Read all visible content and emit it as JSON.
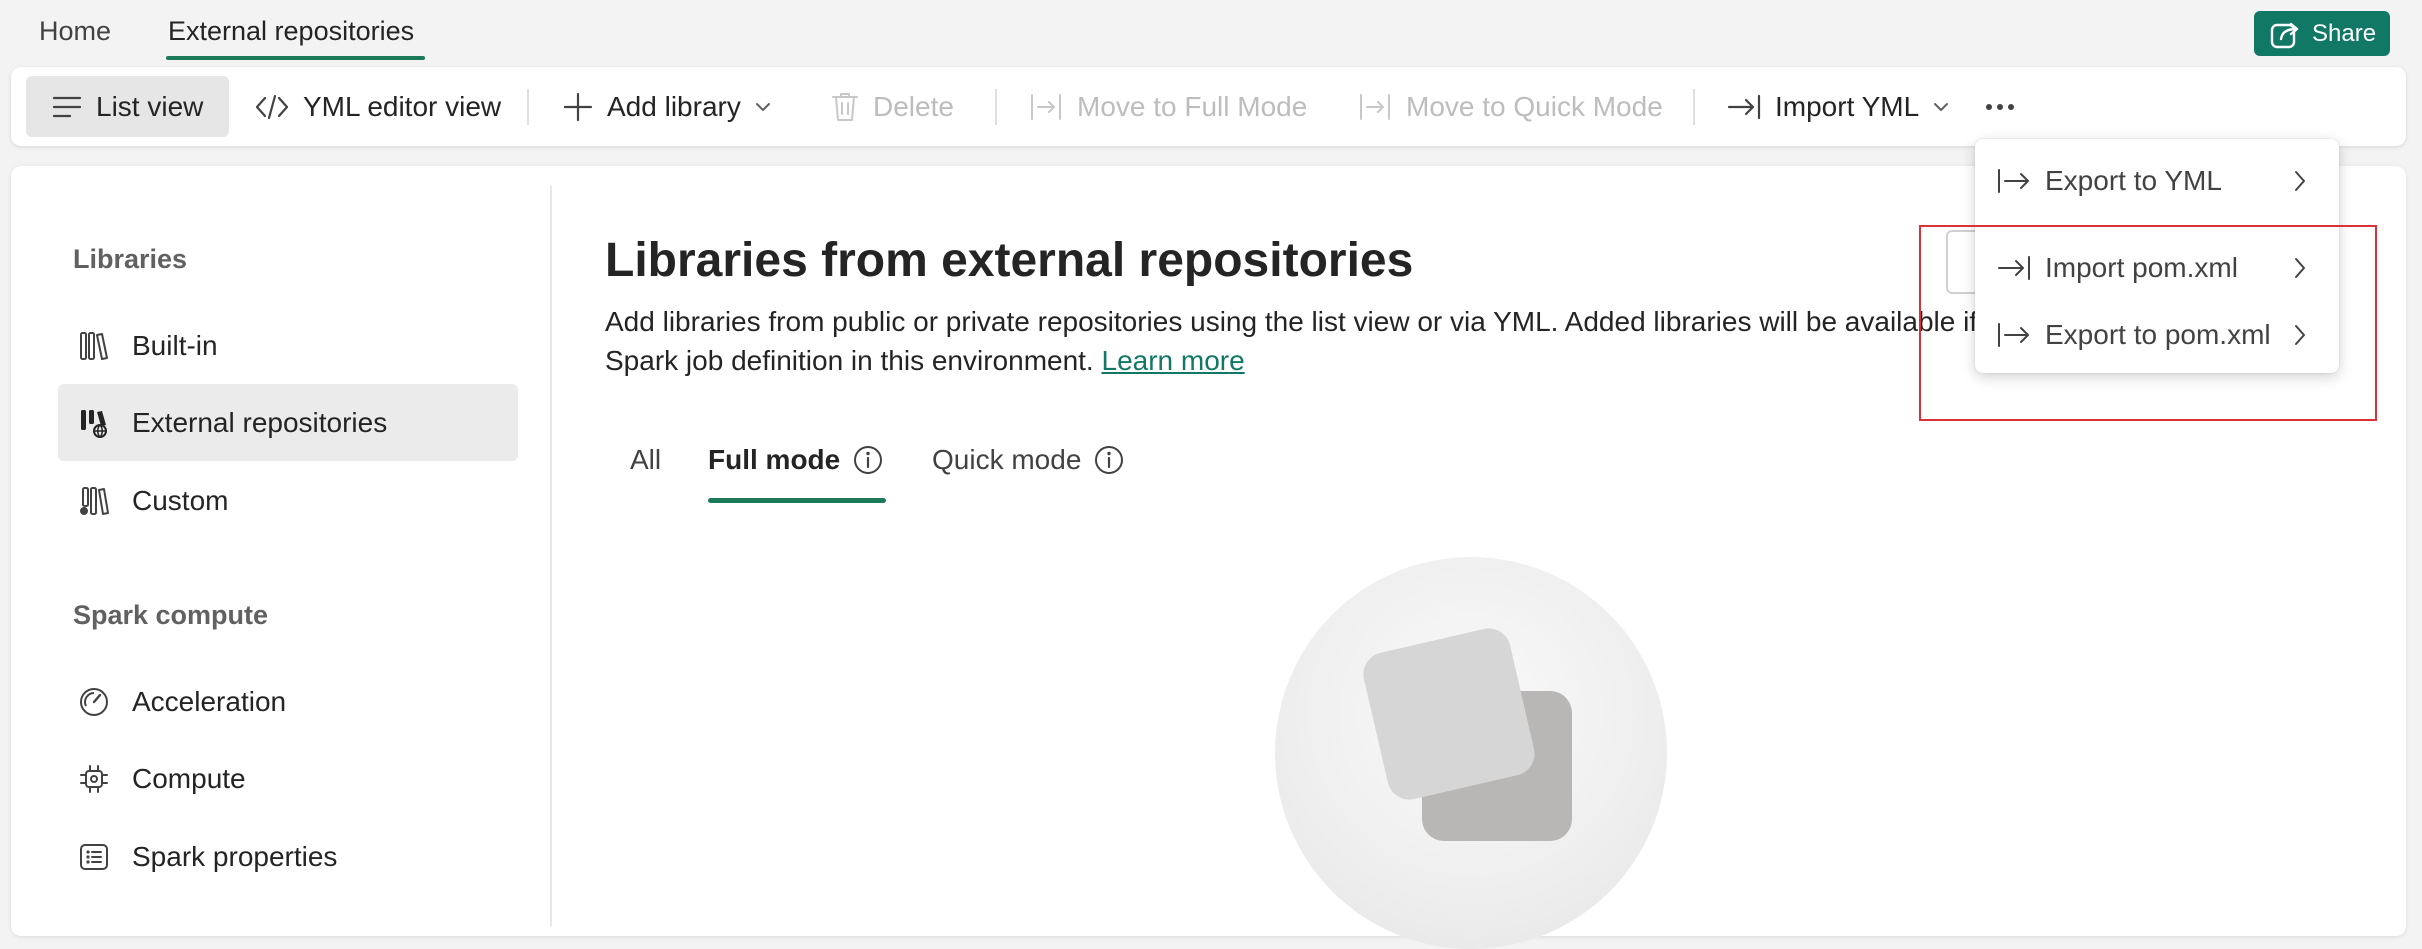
{
  "topnav": {
    "tabs": [
      {
        "label": "Home"
      },
      {
        "label": "External repositories"
      }
    ],
    "share_label": "Share"
  },
  "toolbar": {
    "list_view": "List view",
    "yml_editor_view": "YML editor view",
    "add_library": "Add library",
    "delete": "Delete",
    "move_full": "Move to Full Mode",
    "move_quick": "Move to Quick Mode",
    "import_yml": "Import YML"
  },
  "sidebar": {
    "libraries_heading": "Libraries",
    "library_items": [
      {
        "label": "Built-in"
      },
      {
        "label": "External repositories"
      },
      {
        "label": "Custom"
      }
    ],
    "spark_heading": "Spark compute",
    "spark_items": [
      {
        "label": "Acceleration"
      },
      {
        "label": "Compute"
      },
      {
        "label": "Spark properties"
      }
    ]
  },
  "main": {
    "title": "Libraries from external repositories",
    "description_line1": "Add libraries from public or private repositories using the list view or via YML. Added libraries will be available if yo",
    "description_line2": "Spark job definition in this environment.",
    "learn_more": "Learn more",
    "tabs": [
      {
        "label": "All"
      },
      {
        "label": "Full mode"
      },
      {
        "label": "Quick mode"
      }
    ]
  },
  "menu": {
    "items": [
      {
        "label": "Export to YML"
      },
      {
        "label": "Import pom.xml"
      },
      {
        "label": "Export to pom.xml"
      }
    ]
  },
  "colors": {
    "accent": "#117865",
    "underline": "#1c7a59",
    "highlight": "#d9323b"
  }
}
